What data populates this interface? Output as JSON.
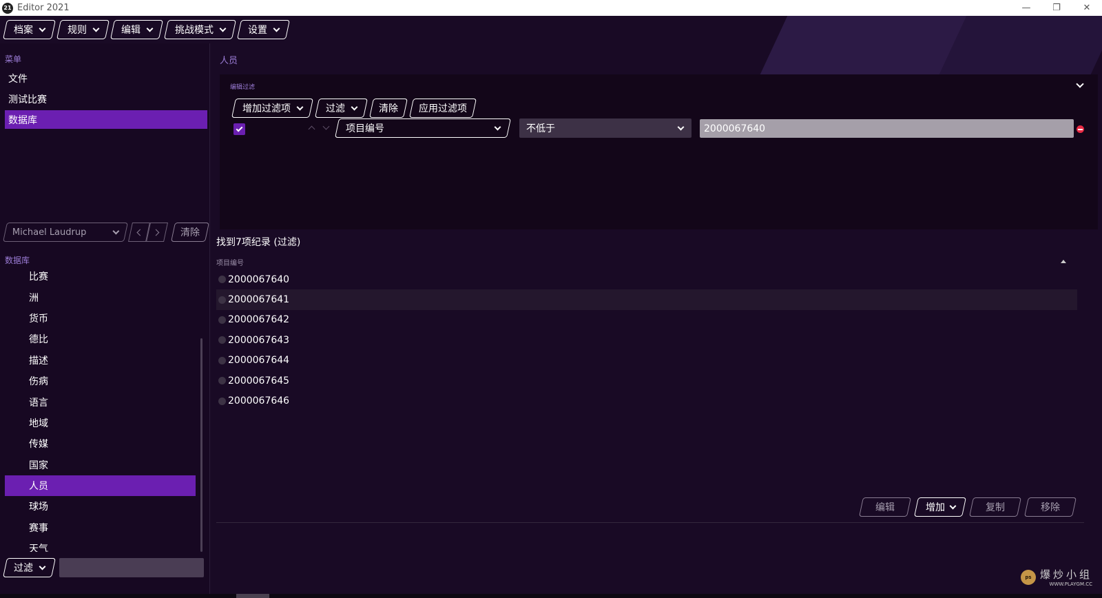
{
  "window": {
    "logo_text": "21",
    "title": "Editor 2021"
  },
  "menubar": {
    "items": [
      "档案",
      "规则",
      "编辑",
      "挑战模式",
      "设置"
    ]
  },
  "sidebar": {
    "menu_label": "菜单",
    "menu_items": [
      "文件",
      "测试比赛",
      "数据库"
    ],
    "active_menu": "数据库",
    "player": {
      "name": "Michael Laudrup",
      "clear_label": "清除"
    },
    "database_label": "数据库",
    "database_items": [
      "比赛",
      "洲",
      "货币",
      "德比",
      "描述",
      "伤病",
      "语言",
      "地域",
      "传媒",
      "国家",
      "人员",
      "球场",
      "赛事",
      "天气"
    ],
    "active_database": "人员",
    "filter_label": "过滤",
    "filter_input_value": ""
  },
  "main": {
    "title": "人员",
    "filter_panel": {
      "label": "编辑过滤",
      "buttons": [
        "增加过滤项",
        "过滤",
        "清除",
        "应用过滤项"
      ],
      "row": {
        "checked": true,
        "field": "项目编号",
        "operator": "不低于",
        "value": "2000067640"
      }
    },
    "result_count": "找到7项纪录 (过滤)",
    "column_header": "项目编号",
    "rows": [
      "2000067640",
      "2000067641",
      "2000067642",
      "2000067643",
      "2000067644",
      "2000067645",
      "2000067646"
    ],
    "actions": [
      "编辑",
      "增加",
      "复制",
      "移除"
    ]
  },
  "watermark": {
    "logo": "ps",
    "text": "爆炒小组",
    "url": "WWW.PLAYGM.CC"
  },
  "colors": {
    "accent": "#6b1fb1",
    "background": "#190a25",
    "label": "#9b7cd6",
    "remove": "#e82b45"
  }
}
